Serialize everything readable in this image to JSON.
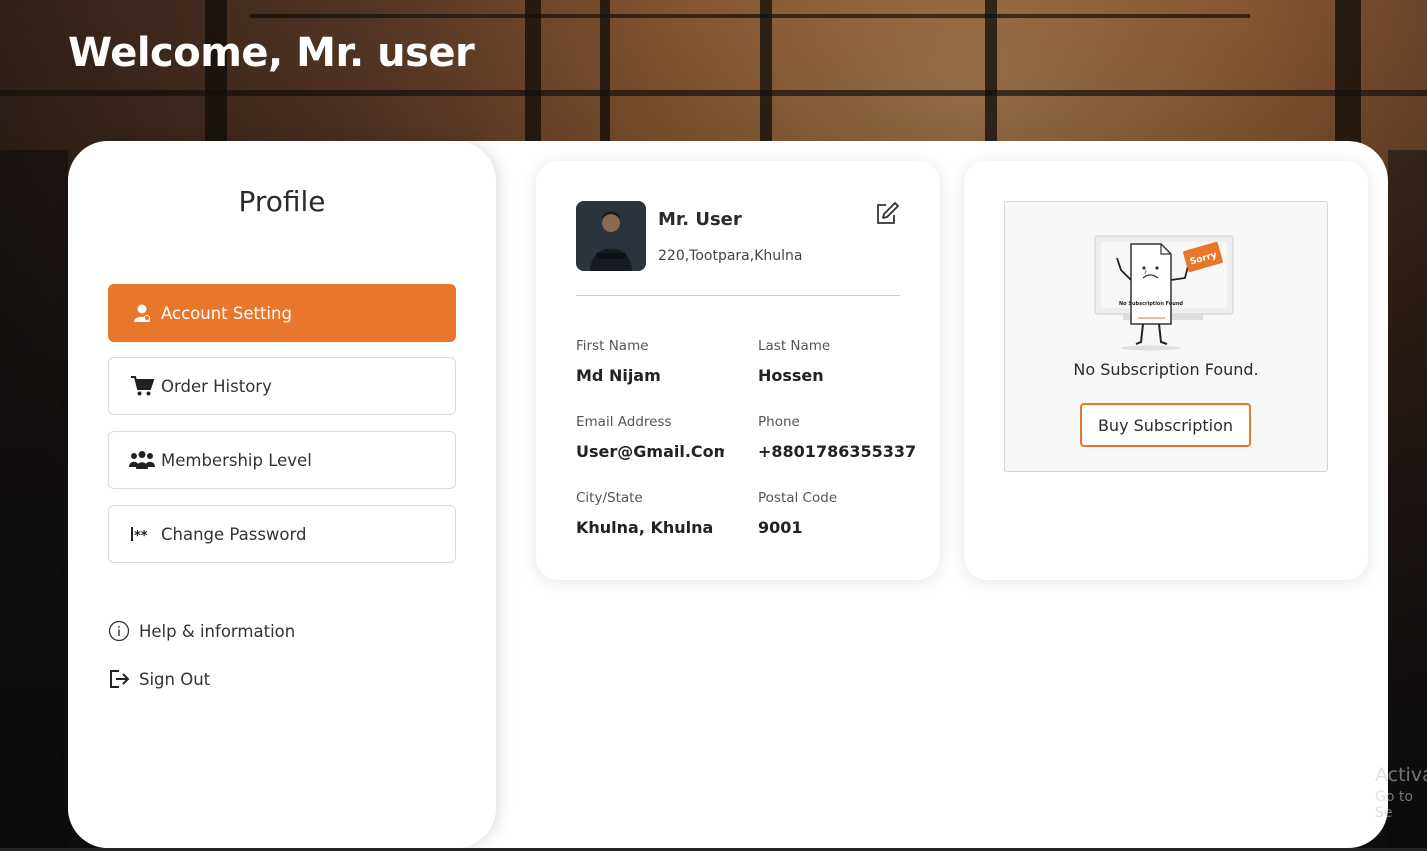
{
  "header": {
    "welcome_text": "Welcome, Mr. user"
  },
  "sidebar": {
    "title": "Profile",
    "menu": [
      {
        "label": "Account Setting",
        "icon": "user-icon",
        "active": true
      },
      {
        "label": "Order History",
        "icon": "cart-icon",
        "active": false
      },
      {
        "label": "Membership Level",
        "icon": "group-icon",
        "active": false
      },
      {
        "label": "Change Password",
        "icon": "password-icon",
        "active": false
      }
    ],
    "links": [
      {
        "label": "Help & information",
        "icon": "info-icon"
      },
      {
        "label": "Sign Out",
        "icon": "sign-out-icon"
      }
    ]
  },
  "profile": {
    "name": "Mr. User",
    "address": "220,Tootpara,Khulna",
    "fields": {
      "first_name_label": "First Name",
      "first_name": "Md Nijam",
      "last_name_label": "Last Name",
      "last_name": "Hossen",
      "email_label": "Email Address",
      "email": "User@Gmail.Com",
      "phone_label": "Phone",
      "phone": "+8801786355337",
      "city_label": "City/State",
      "city": "Khulna, Khulna",
      "postal_label": "Postal Code",
      "postal": "9001"
    }
  },
  "subscription": {
    "illustration_sign": "Sorry",
    "illustration_doc_text": "No Subscription Found",
    "status_text": "No Subscription Found.",
    "buy_label": "Buy Subscription"
  },
  "watermark": {
    "line1": "Activa",
    "line2": "Go to Se"
  },
  "colors": {
    "accent": "#e8762b"
  }
}
